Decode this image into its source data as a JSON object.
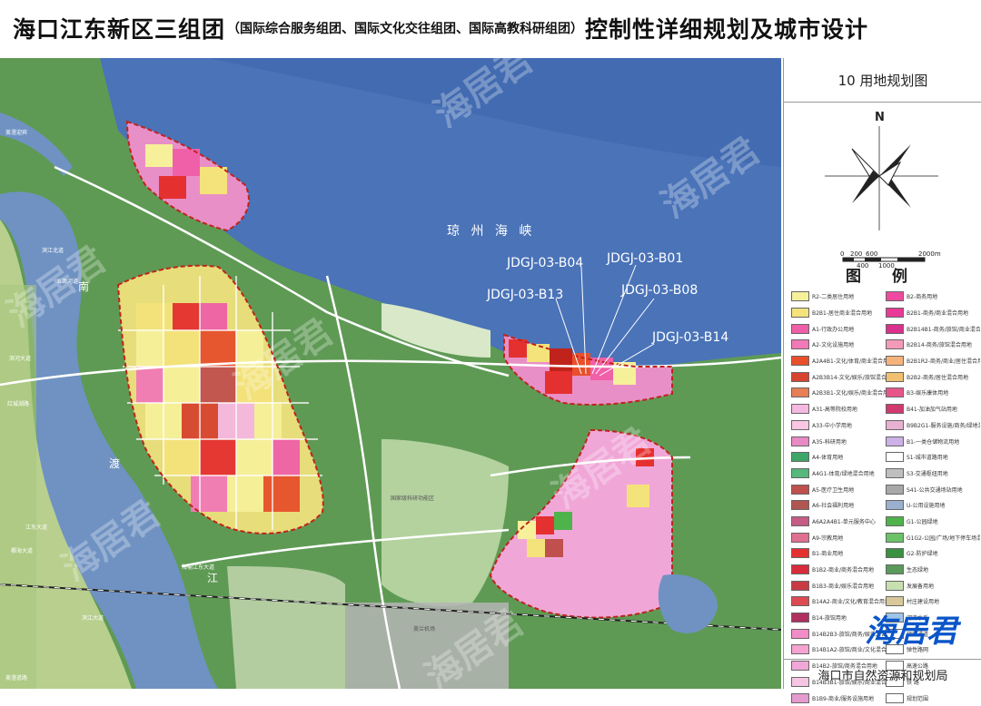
{
  "title": {
    "main": "海口江东新区三组团",
    "sub": "（国际综合服务组团、国际文化交往组团、国际高教科研组团）",
    "tail": "控制性详细规划及城市设计"
  },
  "panel": {
    "map_number": "10  用地规划图",
    "north": "N",
    "scale_top": [
      "0",
      "200",
      "600",
      "2000m"
    ],
    "scale_bottom": [
      "400",
      "1000"
    ],
    "legend_title": "图 例",
    "footer": "海口市自然资源和规划局"
  },
  "legend_left": [
    {
      "label": "R2-二类居住用地",
      "color": "#f6f09a"
    },
    {
      "label": "B2B1-居住商业混合用地",
      "color": "#f4e37a"
    },
    {
      "label": "A1-行政办公用地",
      "color": "#f060a8"
    },
    {
      "label": "A2-文化设施用地",
      "color": "#f279b7"
    },
    {
      "label": "A2A4B1-文化/体育/商业混合用地",
      "color": "#e8502c"
    },
    {
      "label": "A2B3B14-文化/娱乐/旅馆混合用地",
      "color": "#d84430"
    },
    {
      "label": "A2B3B1-文化/娱乐/商业混合用地",
      "color": "#e67f55"
    },
    {
      "label": "A31-高等院校用地",
      "color": "#f5b8e0"
    },
    {
      "label": "A33-中小学用地",
      "color": "#f9c7e4"
    },
    {
      "label": "A35-科研用地",
      "color": "#e88ac4"
    },
    {
      "label": "A4-体育用地",
      "color": "#3fa66a"
    },
    {
      "label": "A4G1-体育/绿地混合用地",
      "color": "#56b87a"
    },
    {
      "label": "A5-医疗卫生用地",
      "color": "#c0504d"
    },
    {
      "label": "A6-社会福利用地",
      "color": "#b05552"
    },
    {
      "label": "A6A2A4B1-单元服务中心",
      "color": "#c45c85"
    },
    {
      "label": "A9-宗教用地",
      "color": "#e07090"
    },
    {
      "label": "B1-商业用地",
      "color": "#e53030"
    },
    {
      "label": "B1B2-商业/商务混合用地",
      "color": "#d82c3c"
    },
    {
      "label": "B1B3-商业/娱乐混合用地",
      "color": "#c93a45"
    },
    {
      "label": "B14A2-商业/文化/教育混合用地",
      "color": "#dd4a52"
    },
    {
      "label": "B14-旅馆用地",
      "color": "#b03060"
    },
    {
      "label": "B14B2B3-旅馆/商务/娱乐混合用地",
      "color": "#f28cc6"
    },
    {
      "label": "B14B1A2-旅馆/商业/文化混合用地",
      "color": "#f5a3d0"
    },
    {
      "label": "B14B2-旅馆/商务混合用地",
      "color": "#f0a7d8"
    },
    {
      "label": "B14B3B1-旅馆/娱乐/商业混合用地",
      "color": "#f6c5e3"
    },
    {
      "label": "B1B9-商业/服务设施用地",
      "color": "#e59ad0"
    }
  ],
  "legend_right": [
    {
      "label": "B2-商务用地",
      "color": "#f04aa0"
    },
    {
      "label": "B2B1-商务/商业混合用地",
      "color": "#e83a96"
    },
    {
      "label": "B2B14B1-商务/旅馆/商业混合用地",
      "color": "#d8328c"
    },
    {
      "label": "B2B14-商务/旅馆混合用地",
      "color": "#f39ab6"
    },
    {
      "label": "B2B1R2-商务/商业/居住混合用地",
      "color": "#f5b27a"
    },
    {
      "label": "B2B2-商务/居住混合用地",
      "color": "#f0c070"
    },
    {
      "label": "B3-娱乐康体用地",
      "color": "#e8558a"
    },
    {
      "label": "B41-加油加气站用地",
      "color": "#d03a70"
    },
    {
      "label": "B9B2G1-服务设施/商务/绿地混合用地",
      "color": "#e6b1d2"
    },
    {
      "label": "B1-一类仓储物流用地",
      "color": "#cbb1e6"
    },
    {
      "label": "S1-城市道路用地",
      "color": "#ffffff"
    },
    {
      "label": "S3-交通枢纽用地",
      "color": "#bfbfbf"
    },
    {
      "label": "S41-公共交通场站用地",
      "color": "#a8a8a8"
    },
    {
      "label": "U-公用设施用地",
      "color": "#9bb0cf"
    },
    {
      "label": "G1-公园绿地",
      "color": "#4fb34b"
    },
    {
      "label": "G1G2-公园/广场/地下停车场混合用地",
      "color": "#6cc267"
    },
    {
      "label": "G2-防护绿地",
      "color": "#3a9140"
    },
    {
      "label": "生态绿地",
      "color": "#5a9a5a"
    },
    {
      "label": "发展备用地",
      "color": "#c8e0b0"
    },
    {
      "label": "村庄建设用地",
      "color": "#d8c89a"
    },
    {
      "label": "河流水系",
      "color": "#9fc4e8"
    },
    {
      "label": "预留通道",
      "color": "#ffffff"
    },
    {
      "label": "弹性路网",
      "color": "#ffffff"
    },
    {
      "label": "高速公路",
      "color": "#ffffff"
    },
    {
      "label": "铁 路",
      "color": "#ffffff"
    },
    {
      "label": "规划范围",
      "color": "#ffffff"
    }
  ],
  "map": {
    "sea_label": "琼 州 海 峡",
    "parcel_codes": [
      "JDGJ-03-B04",
      "JDGJ-03-B01",
      "JDGJ-03-B13",
      "JDGJ-03-B08",
      "JDGJ-03-B14"
    ],
    "river_chars": [
      "南",
      "渡",
      "江"
    ],
    "roads": [
      "美澄迎宾",
      "滨江北道",
      "五源河道",
      "滨河大道",
      "红城湖路",
      "江东大道",
      "椰海大道",
      "海榆江东大道",
      "滨江大道",
      "美澄道路",
      "美兰机场",
      "国家级科研功能区"
    ],
    "watermark": "海居君",
    "badge": "海居君"
  },
  "colors": {
    "sea": "#4a73b8",
    "river": "#6f92c2",
    "green": "#5f9a55",
    "accent_red": "#c0231b"
  }
}
